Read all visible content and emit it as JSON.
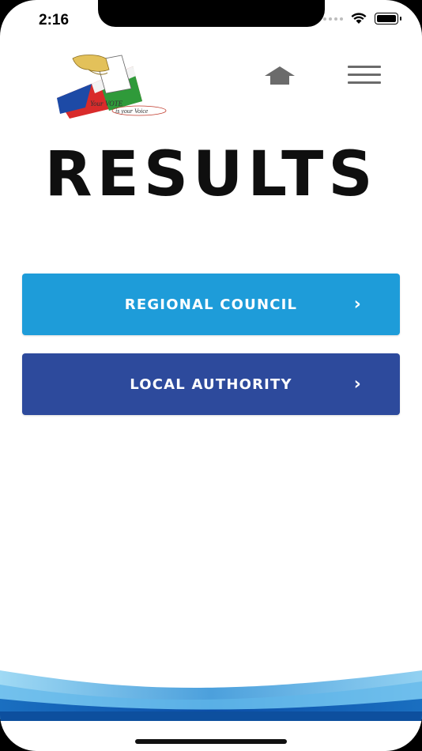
{
  "status_bar": {
    "time": "2:16"
  },
  "header": {
    "logo": {
      "line1": "Your VOTE",
      "line2": "is your Voice"
    }
  },
  "page": {
    "title": "RESULTS"
  },
  "buttons": [
    {
      "label": "REGIONAL COUNCIL",
      "color": "#1E9CD9"
    },
    {
      "label": "LOCAL AUTHORITY",
      "color": "#2D4A9C"
    }
  ],
  "icons": {
    "home": "home-icon",
    "menu": "hamburger-menu-icon",
    "chevron": "chevron-right-icon"
  },
  "colors": {
    "title": "#0F0F0F",
    "icon_gray": "#6B6B6B",
    "footer_blue": "#1B78C8"
  }
}
